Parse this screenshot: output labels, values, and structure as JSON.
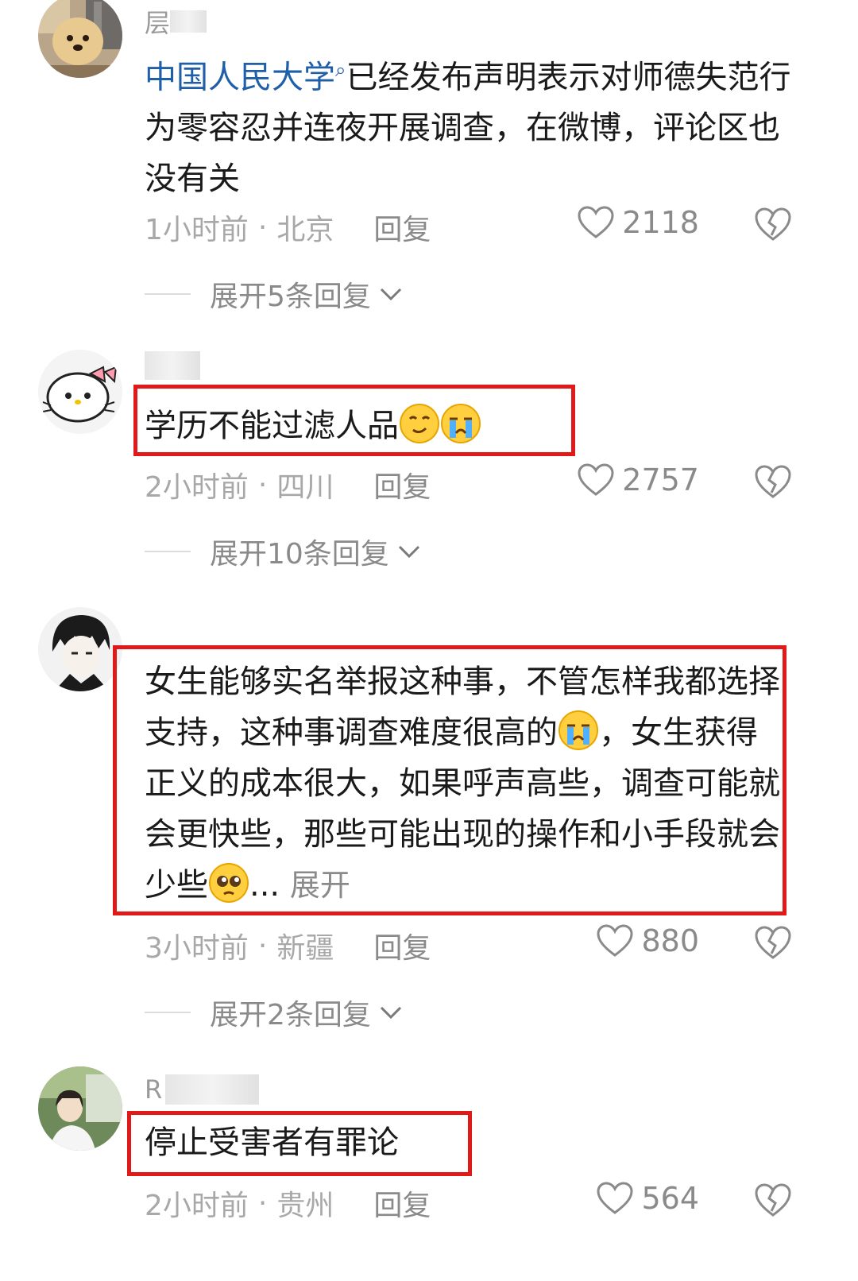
{
  "colors": {
    "mention": "#1f5fa8",
    "highlight_box": "#e01919",
    "meta": "#a8a8a8"
  },
  "comments": [
    {
      "username": "层",
      "mention": "中国人民大学",
      "mention_icon": "search-icon",
      "text": "已经发布声明表示对师德失范行为零容忍并连夜开展调查，在微博，评论区也没有关",
      "time": "1小时前",
      "location": "北京",
      "reply_label": "回复",
      "likes": "2118",
      "expand_label": "展开5条回复"
    },
    {
      "username": "",
      "text": "学历不能过滤人品",
      "emojis": [
        "smirk-emoji",
        "crying-emoji"
      ],
      "time": "2小时前",
      "location": "四川",
      "reply_label": "回复",
      "likes": "2757",
      "expand_label": "展开10条回复"
    },
    {
      "username": "",
      "text_part1": "女生能够实名举报这种事，不管怎样我都选择支持，这种事调查难度很高的",
      "text_part2": "，女生获得正义的成本很大，如果呼声高些，调查可能就会更快些，那些可能出现的操作和小手段就会少些",
      "text_ellipsis": "...",
      "more_label": "展开",
      "emojis": [
        "crying-emoji",
        "pleading-emoji"
      ],
      "time": "3小时前",
      "location": "新疆",
      "reply_label": "回复",
      "likes": "880",
      "expand_label": "展开2条回复"
    },
    {
      "username": "R",
      "text": "停止受害者有罪论",
      "time": "2小时前",
      "location": "贵州",
      "reply_label": "回复",
      "likes": "564"
    }
  ],
  "meta_separator": "·"
}
